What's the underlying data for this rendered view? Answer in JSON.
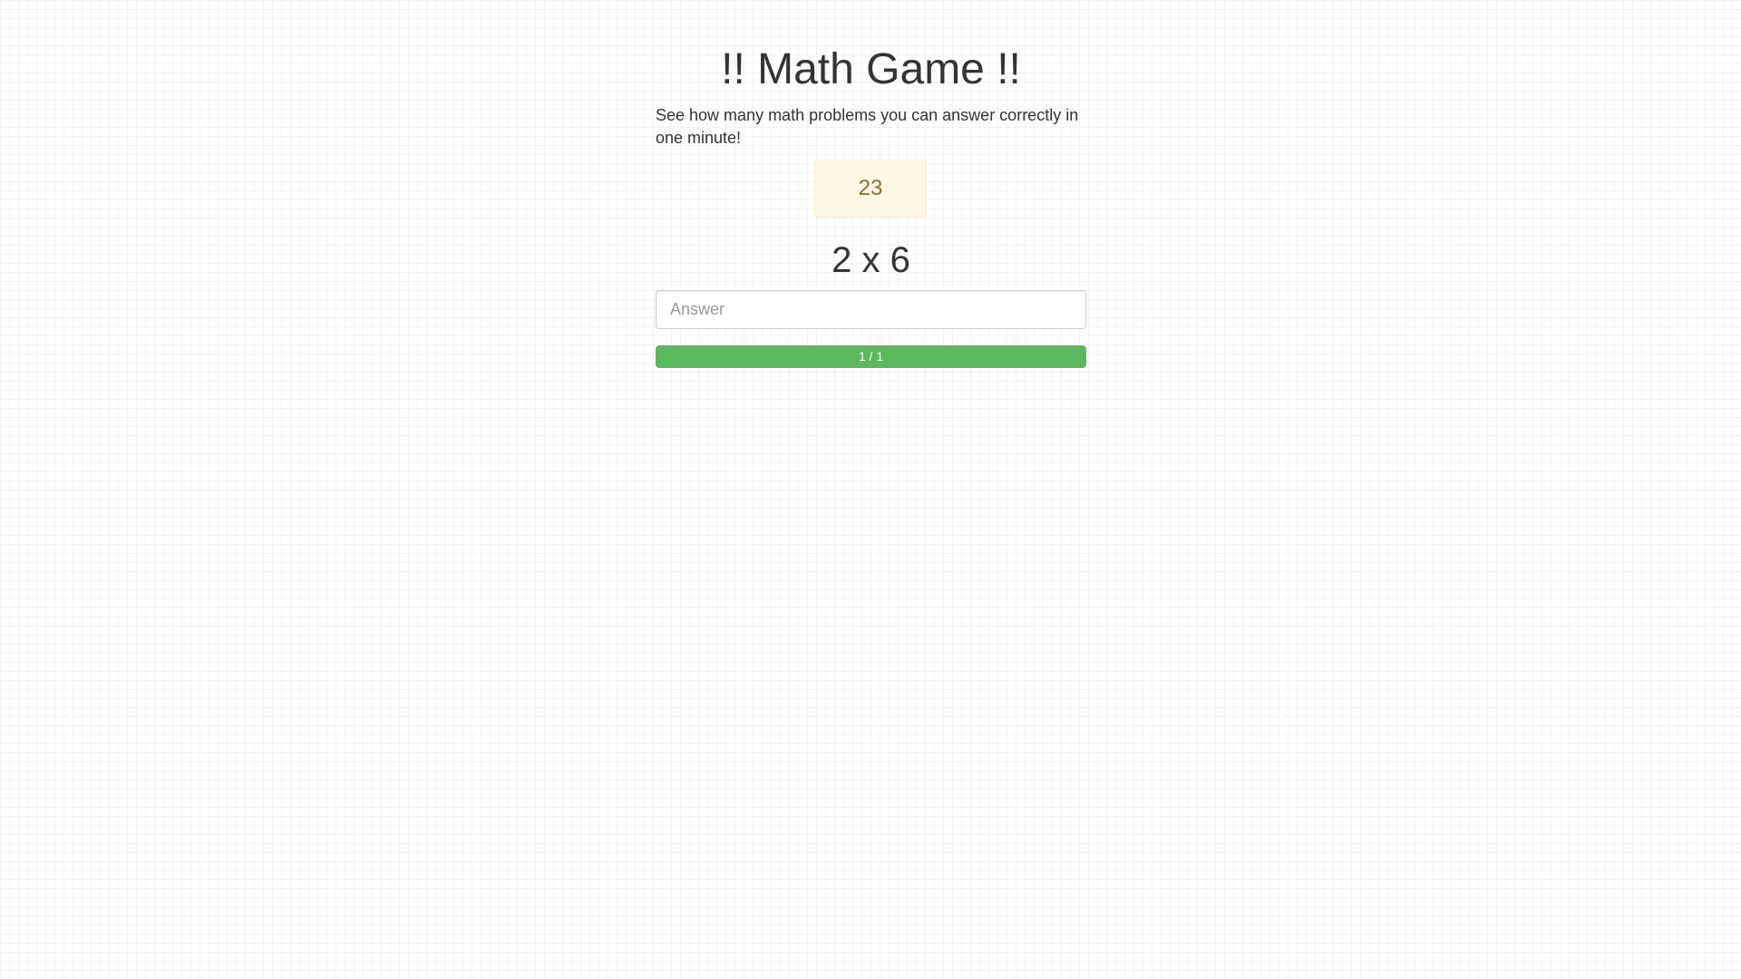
{
  "game": {
    "title": "!! Math Game !!",
    "subtitle": "See how many math problems you can answer correctly in one minute!",
    "timer": "23",
    "problem": "2 x 6",
    "answer": {
      "value": "",
      "placeholder": "Answer"
    },
    "progress": {
      "label": "1 / 1",
      "fraction": 1.0
    }
  },
  "colors": {
    "timer_background": "#fcf8e3",
    "timer_text": "#8a6d3b",
    "progress_bar": "#5cb85c"
  }
}
